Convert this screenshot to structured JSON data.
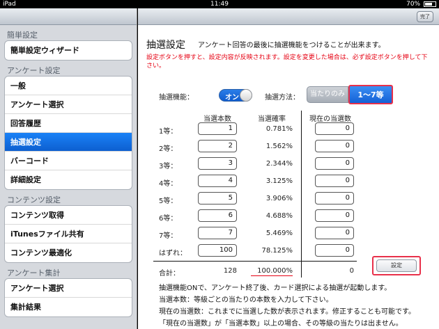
{
  "statusbar": {
    "device": "iPad",
    "time": "11:49",
    "battery": "70%",
    "battery_level": 0.7
  },
  "sidebar": {
    "sections": [
      {
        "title": "簡単設定",
        "items": [
          "簡単設定ウィザード"
        ]
      },
      {
        "title": "アンケート設定",
        "items": [
          "一般",
          "アンケート選択",
          "回答履歴",
          "抽選設定",
          "バーコード",
          "詳細設定"
        ]
      },
      {
        "title": "コンテンツ設定",
        "items": [
          "コンテンツ取得",
          "iTunesファイル共有",
          "コンテンツ最適化"
        ]
      },
      {
        "title": "アンケート集計",
        "items": [
          "アンケート選択",
          "集計結果"
        ]
      }
    ],
    "selected_item": "抽選設定"
  },
  "navbar": {
    "done_label": "完了"
  },
  "main": {
    "title": "抽選設定",
    "description": "アンケート回答の最後に抽選機能をつけることが出来ます。",
    "warning": "設定ボタンを押すと、設定内容が反映されます。設定を変更した場合は、必ず設定ボタンを押して下さい。",
    "lottery_label": "抽選機能：",
    "toggle_text": "オン",
    "method_label": "抽選方法：",
    "method_options": [
      "当たりのみ",
      "1〜7等"
    ],
    "method_selected": "1〜7等",
    "headers": {
      "count": "当選本数",
      "probability": "当選確率",
      "current": "現在の当選数"
    },
    "rows": [
      {
        "rank": "1等：",
        "count": "1",
        "pct": "0.781%",
        "current": "0"
      },
      {
        "rank": "2等：",
        "count": "2",
        "pct": "1.562%",
        "current": "0"
      },
      {
        "rank": "3等：",
        "count": "3",
        "pct": "2.344%",
        "current": "0"
      },
      {
        "rank": "4等：",
        "count": "4",
        "pct": "3.125%",
        "current": "0"
      },
      {
        "rank": "5等：",
        "count": "5",
        "pct": "3.906%",
        "current": "0"
      },
      {
        "rank": "6等：",
        "count": "6",
        "pct": "4.688%",
        "current": "0"
      },
      {
        "rank": "7等：",
        "count": "7",
        "pct": "5.469%",
        "current": "0"
      },
      {
        "rank": "はずれ：",
        "count": "100",
        "pct": "78.125%",
        "current": "0"
      }
    ],
    "total": {
      "label": "合計：",
      "count": "128",
      "pct": "100.000%",
      "current": "0"
    },
    "set_button": "設定",
    "notes": [
      "抽選機能ONで、アンケート終了後、カード選択による抽選が起動します。",
      "当選本数：等級ごとの当たりの本数を入力して下さい。",
      "現在の当選数：これまでに当選した数が表示されます。修正することも可能です。",
      "「現在の当選数」が「当選本数」以上の場合、その等級の当たりは出ません。"
    ]
  }
}
